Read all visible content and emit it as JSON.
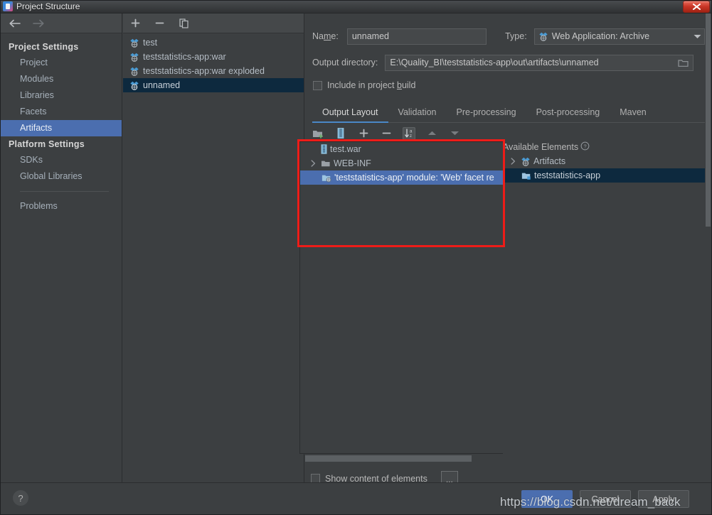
{
  "window": {
    "title": "Project Structure",
    "icon": "intellij-logo-icon",
    "close_label": "✕"
  },
  "nav": {
    "back_icon": "arrow-left-icon",
    "forward_icon": "arrow-right-icon"
  },
  "sidebar": {
    "groups": [
      {
        "label": "Project Settings",
        "items": [
          {
            "label": "Project",
            "selected": false
          },
          {
            "label": "Modules",
            "selected": false
          },
          {
            "label": "Libraries",
            "selected": false
          },
          {
            "label": "Facets",
            "selected": false
          },
          {
            "label": "Artifacts",
            "selected": true
          }
        ]
      },
      {
        "label": "Platform Settings",
        "items": [
          {
            "label": "SDKs",
            "selected": false
          },
          {
            "label": "Global Libraries",
            "selected": false
          }
        ]
      }
    ],
    "problems": {
      "label": "Problems"
    }
  },
  "artifacts_panel": {
    "toolbar": [
      {
        "name": "add-artifact-button",
        "icon": "plus-icon",
        "label": "+"
      },
      {
        "name": "remove-artifact-button",
        "icon": "minus-icon",
        "label": "−"
      },
      {
        "name": "copy-artifact-button",
        "icon": "copy-icon",
        "label": ""
      }
    ],
    "items": [
      {
        "label": "test",
        "selected": false
      },
      {
        "label": "teststatistics-app:war",
        "selected": false
      },
      {
        "label": "teststatistics-app:war exploded",
        "selected": false
      },
      {
        "label": "unnamed",
        "selected": true
      }
    ]
  },
  "editor": {
    "name_label": "Name:",
    "name_value": "unnamed",
    "type_label": "Type:",
    "type_value": "Web Application: Archive",
    "output_dir_label": "Output directory:",
    "output_dir_value": "E:\\Quality_BI\\teststatistics-app\\out\\artifacts\\unnamed",
    "browse_icon": "folder-icon",
    "include_in_build_label": "Include in project build",
    "include_in_build_checked": false,
    "tabs": [
      {
        "label": "Output Layout",
        "active": true
      },
      {
        "label": "Validation",
        "active": false
      },
      {
        "label": "Pre-processing",
        "active": false
      },
      {
        "label": "Post-processing",
        "active": false
      },
      {
        "label": "Maven",
        "active": false
      }
    ],
    "layout_toolbar": [
      {
        "name": "create-directory-button",
        "icon": "folder-add-icon"
      },
      {
        "name": "create-archive-button",
        "icon": "archive-icon"
      },
      {
        "name": "add-copy-of-button",
        "icon": "plus-icon"
      },
      {
        "name": "remove-element-button",
        "icon": "minus-icon"
      },
      {
        "name": "sort-alphabetically-button",
        "icon": "sort-az-icon"
      },
      {
        "name": "move-up-button",
        "icon": "chevron-up-icon"
      },
      {
        "name": "move-down-button",
        "icon": "chevron-down-icon"
      }
    ],
    "output_tree": [
      {
        "label": "test.war",
        "icon": "archive-icon",
        "indent": 0,
        "twisty": "none",
        "state": "normal"
      },
      {
        "label": "WEB-INF",
        "icon": "folder-icon",
        "indent": 0,
        "twisty": "collapsed",
        "state": "normal"
      },
      {
        "label": "'teststatistics-app' module: 'Web' facet re",
        "icon": "facet-icon",
        "indent": 1,
        "twisty": "none",
        "state": "selected-blue"
      }
    ],
    "available": {
      "header_label": "Available Elements",
      "help_icon": "help-circle-icon",
      "items": [
        {
          "label": "Artifacts",
          "icon": "artifact-icon",
          "indent": 0,
          "twisty": "collapsed",
          "state": "normal"
        },
        {
          "label": "teststatistics-app",
          "icon": "module-icon",
          "indent": 1,
          "twisty": "none",
          "state": "selected-navy"
        }
      ]
    },
    "show_content_label": "Show content of elements",
    "show_content_checked": false,
    "dots_button_label": "..."
  },
  "footer": {
    "help_label": "?",
    "buttons": [
      {
        "label": "OK",
        "primary": true
      },
      {
        "label": "Cancel",
        "primary": false
      },
      {
        "label": "Apply",
        "primary": false
      }
    ]
  },
  "watermark": {
    "text": "https://blog.csdn.net/dream_back"
  },
  "colors": {
    "background": "#3c3f41",
    "panel": "#45484a",
    "selection_blue": "#4b6eaf",
    "selection_navy": "#0d293e",
    "accent": "#4a88c7",
    "annotation_red": "#ee1c18",
    "close_red": "#c93526"
  }
}
